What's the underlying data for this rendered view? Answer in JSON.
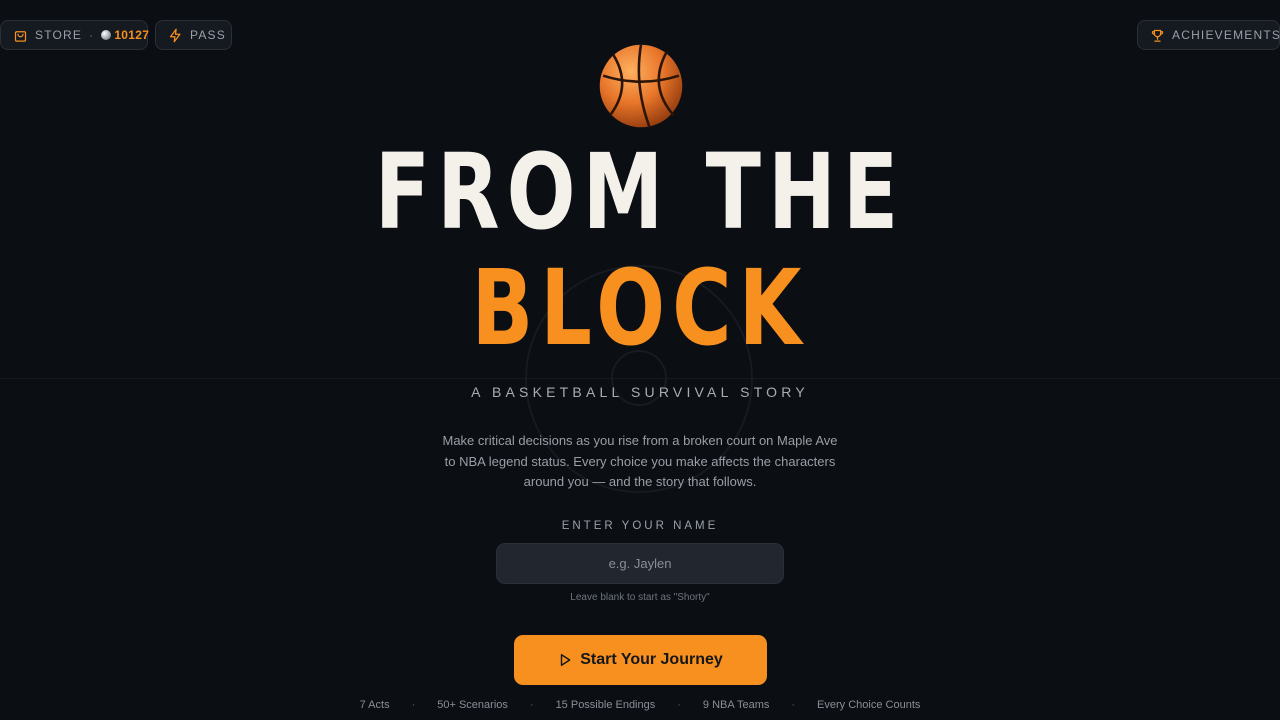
{
  "topbar": {
    "store_label": "STORE",
    "store_separator": "·",
    "coins": "10127",
    "pass_label": "PASS",
    "achievements_label": "ACHIEVEMENTS"
  },
  "hero": {
    "title_line1": "FROM THE",
    "title_line2": "BLOCK",
    "subtitle": "A BASKETBALL SURVIVAL STORY",
    "description": "Make critical decisions as you rise from a broken court on Maple Ave to NBA legend status. Every choice you make affects the characters around you — and the story that follows."
  },
  "name_form": {
    "label": "ENTER YOUR NAME",
    "placeholder": "e.g. Jaylen",
    "value": "",
    "hint": "Leave blank to start as \"Shorty\""
  },
  "start_button": {
    "label": "Start Your Journey"
  },
  "stats": [
    "7 Acts",
    "50+ Scenarios",
    "15 Possible Endings",
    "9 NBA Teams",
    "Every Choice Counts"
  ],
  "colors": {
    "accent": "#f7901e",
    "background": "#0b0e13",
    "title_white": "#f4f1ea"
  },
  "icons": {
    "store": "shopping-bag-icon",
    "pass": "lightning-icon",
    "achievements": "trophy-icon",
    "start": "play-icon",
    "hero": "basketball-icon"
  }
}
